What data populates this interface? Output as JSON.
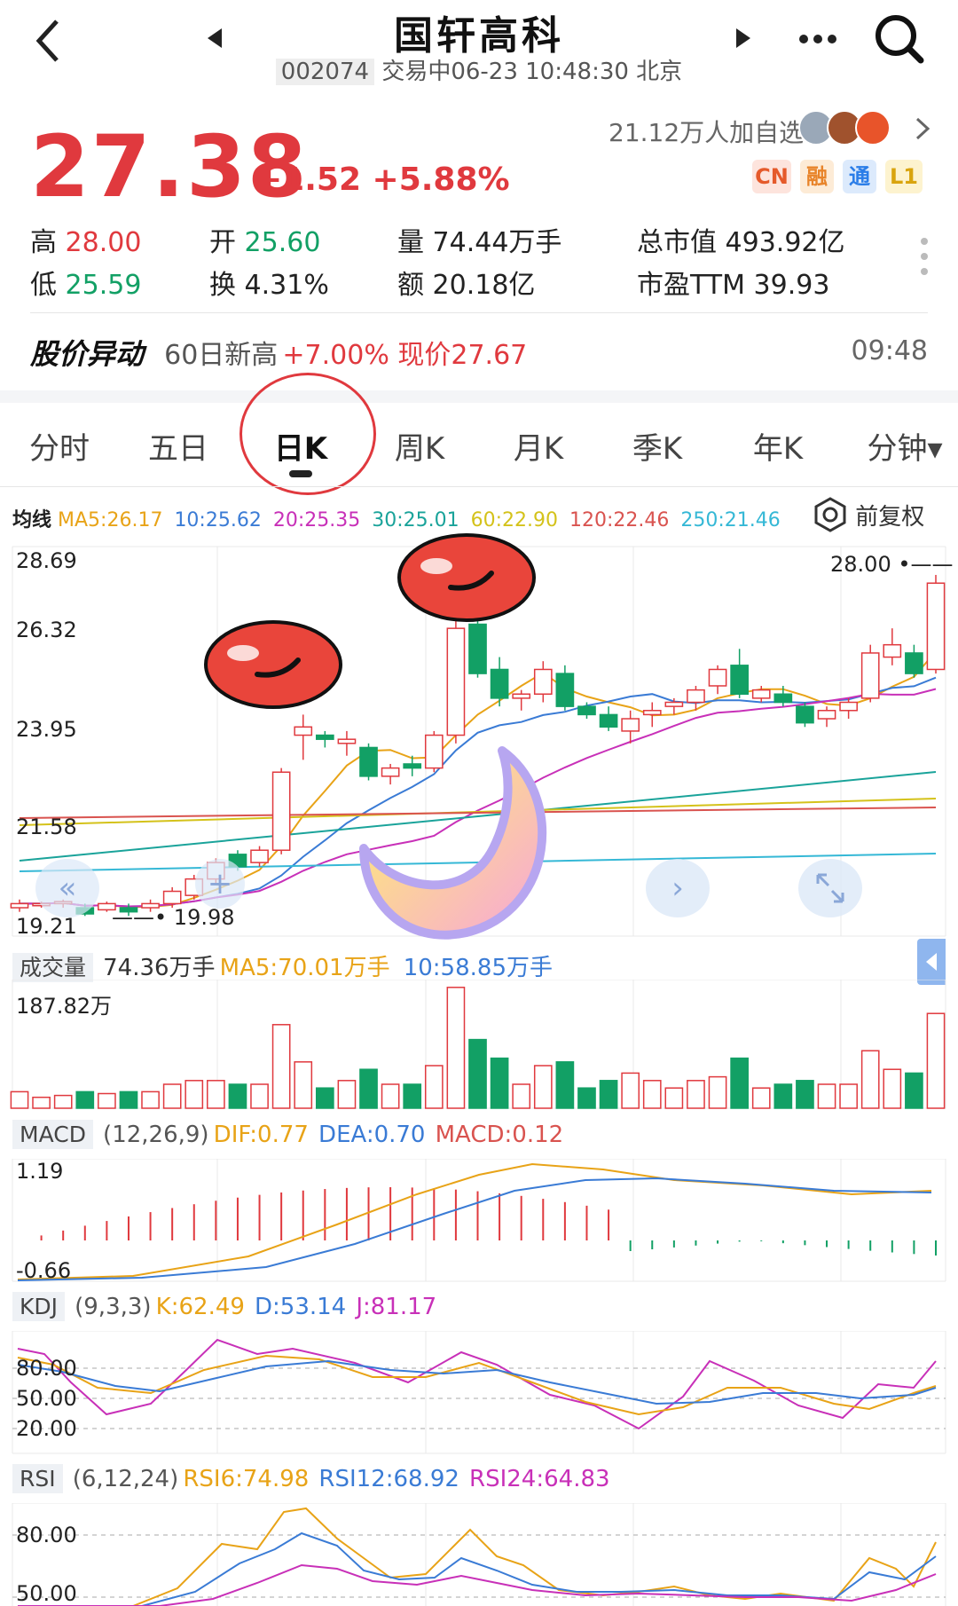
{
  "header": {
    "title": "国轩高科",
    "code": "002074",
    "status": "交易中06-23 10:48:30 北京"
  },
  "quote": {
    "price": "27.38",
    "change": "+1.52",
    "change_pct": "+5.88%",
    "watchers": "21.12万人加自选",
    "badges": [
      "CN",
      "融",
      "通",
      "L1"
    ],
    "stats": {
      "high_label": "高",
      "high": "28.00",
      "open_label": "开",
      "open": "25.60",
      "volume": "量 74.44万手",
      "market_cap": "总市值 493.92亿",
      "low_label": "低",
      "low": "25.59",
      "turnover_label": "换",
      "turnover": "4.31%",
      "amount": "额 20.18亿",
      "pe": "市盈TTM 39.93"
    }
  },
  "alert": {
    "title": "股价异动",
    "text": "60日新高",
    "detail": "+7.00% 现价27.67",
    "time": "09:48"
  },
  "tabs": [
    "分时",
    "五日",
    "日K",
    "周K",
    "月K",
    "季K",
    "年K",
    "分钟▾"
  ],
  "active_tab": "日K",
  "ma_legend": {
    "label": "均线",
    "items": [
      {
        "text": "MA5:26.17",
        "color": "#e8a317"
      },
      {
        "text": "10:25.62",
        "color": "#3a7bd5"
      },
      {
        "text": "20:25.35",
        "color": "#c830b8"
      },
      {
        "text": "30:25.01",
        "color": "#1aa39a"
      },
      {
        "text": "60:22.90",
        "color": "#d4c21a"
      },
      {
        "text": "120:22.46",
        "color": "#d9534f"
      },
      {
        "text": "250:21.46",
        "color": "#35b8d6"
      }
    ],
    "adjust": "前复权"
  },
  "kline": {
    "y_ticks": [
      "28.69",
      "26.32",
      "23.95",
      "21.58",
      "19.21"
    ],
    "high_mark": "28.00",
    "low_mark": "19.98",
    "candles": [
      [
        19.9,
        20.0,
        19.8,
        20.1
      ],
      [
        19.95,
        20.0,
        19.9,
        20.05
      ],
      [
        20.0,
        20.05,
        19.9,
        20.1
      ],
      [
        19.9,
        19.75,
        19.7,
        20.0
      ],
      [
        19.85,
        20.0,
        19.8,
        20.05
      ],
      [
        19.9,
        19.8,
        19.7,
        20.0
      ],
      [
        19.9,
        20.0,
        19.8,
        20.1
      ],
      [
        20.0,
        20.3,
        19.9,
        20.4
      ],
      [
        20.2,
        20.6,
        20.1,
        20.7
      ],
      [
        20.6,
        21.0,
        20.5,
        21.1
      ],
      [
        21.2,
        20.9,
        20.8,
        21.3
      ],
      [
        21.0,
        21.3,
        20.9,
        21.4
      ],
      [
        21.3,
        23.2,
        21.2,
        23.3
      ],
      [
        24.1,
        24.3,
        23.5,
        24.6
      ],
      [
        24.1,
        24.0,
        23.8,
        24.2
      ],
      [
        23.9,
        24.0,
        23.6,
        24.2
      ],
      [
        23.8,
        23.1,
        23.0,
        23.9
      ],
      [
        23.1,
        23.3,
        22.9,
        23.4
      ],
      [
        23.4,
        23.3,
        23.1,
        23.6
      ],
      [
        23.3,
        24.1,
        23.2,
        24.2
      ],
      [
        24.1,
        26.7,
        23.9,
        27.0
      ],
      [
        26.8,
        25.6,
        25.5,
        27.2
      ],
      [
        25.7,
        25.0,
        24.8,
        26.0
      ],
      [
        25.0,
        25.1,
        24.7,
        25.2
      ],
      [
        25.1,
        25.7,
        24.9,
        25.9
      ],
      [
        25.6,
        24.8,
        24.7,
        25.8
      ],
      [
        24.8,
        24.6,
        24.5,
        24.9
      ],
      [
        24.6,
        24.3,
        24.2,
        24.8
      ],
      [
        24.2,
        24.5,
        23.9,
        24.7
      ],
      [
        24.6,
        24.7,
        24.3,
        24.9
      ],
      [
        24.8,
        24.9,
        24.6,
        25.0
      ],
      [
        24.9,
        25.2,
        24.7,
        25.3
      ],
      [
        25.3,
        25.7,
        25.1,
        25.8
      ],
      [
        25.8,
        25.1,
        25.0,
        26.2
      ],
      [
        25.0,
        25.2,
        24.9,
        25.3
      ],
      [
        25.1,
        24.9,
        24.8,
        25.3
      ],
      [
        24.8,
        24.4,
        24.3,
        24.9
      ],
      [
        24.5,
        24.7,
        24.3,
        24.8
      ],
      [
        24.7,
        24.9,
        24.5,
        25.0
      ],
      [
        25.0,
        26.1,
        24.9,
        26.3
      ],
      [
        26.0,
        26.3,
        25.8,
        26.7
      ],
      [
        26.1,
        25.6,
        25.5,
        26.3
      ],
      [
        25.7,
        27.8,
        25.6,
        28.0
      ]
    ]
  },
  "volume": {
    "label": "成交量",
    "value": "74.36万手",
    "ma5": "MA5:70.01万手",
    "ma10": "10:58.85万手",
    "y_tick": "187.82万"
  },
  "macd": {
    "label": "MACD",
    "params": "(12,26,9)",
    "dif": "DIF:0.77",
    "dea": "DEA:0.70",
    "macd": "MACD:0.12",
    "y_top": "1.19",
    "y_bottom": "-0.66"
  },
  "kdj": {
    "label": "KDJ",
    "params": "(9,3,3)",
    "k": "K:62.49",
    "d": "D:53.14",
    "j": "J:81.17",
    "y_ticks": [
      "80.00",
      "50.00",
      "20.00"
    ]
  },
  "rsi": {
    "label": "RSI",
    "params": "(6,12,24)",
    "r6": "RSI6:74.98",
    "r12": "RSI12:68.92",
    "r24": "RSI24:64.83",
    "y_ticks": [
      "80.00",
      "50.00"
    ]
  }
}
